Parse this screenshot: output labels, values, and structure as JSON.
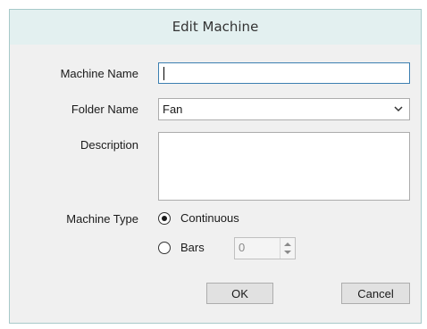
{
  "dialog": {
    "title": "Edit Machine"
  },
  "form": {
    "machine_name": {
      "label": "Machine Name",
      "value": ""
    },
    "folder_name": {
      "label": "Folder Name",
      "value": "Fan",
      "icon": "chevron-down-icon"
    },
    "description": {
      "label": "Description",
      "value": ""
    },
    "machine_type": {
      "label": "Machine Type",
      "options": [
        {
          "label": "Continuous",
          "selected": true
        },
        {
          "label": "Bars",
          "selected": false
        }
      ],
      "bars_count": "0"
    }
  },
  "buttons": {
    "ok": "OK",
    "cancel": "Cancel"
  },
  "colors": {
    "titlebar_bg": "#e3f0f0",
    "dialog_border": "#a7c9c9",
    "dialog_bg": "#f0f0f0",
    "focus_border": "#3c7fb1"
  }
}
